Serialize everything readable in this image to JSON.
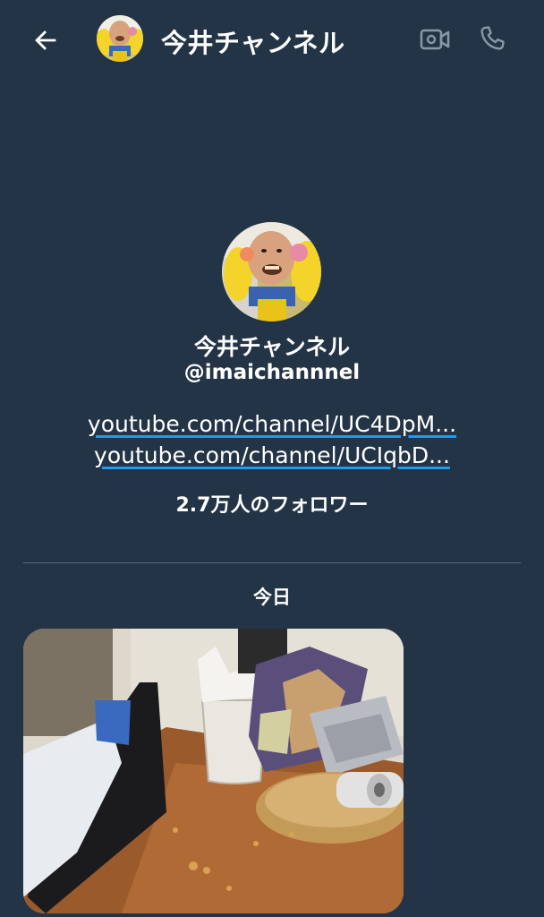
{
  "header": {
    "title": "今井チャンネル",
    "back_icon": "arrow-left-icon",
    "video_icon": "video-camera-icon",
    "call_icon": "phone-icon"
  },
  "profile": {
    "name": "今井チャンネル",
    "handle": "@imaichannnel",
    "links": [
      "youtube.com/channel/UC4DpM...",
      "youtube.com/channel/UCIqbD..."
    ],
    "followers": "2.7万人のフォロワー"
  },
  "conversation": {
    "date_separator": "今日"
  },
  "colors": {
    "background": "#243447",
    "text": "#ffffff",
    "link_underline": "#1d9bf0",
    "icon_muted": "#8899a6",
    "divider": "#5d6b7a"
  }
}
